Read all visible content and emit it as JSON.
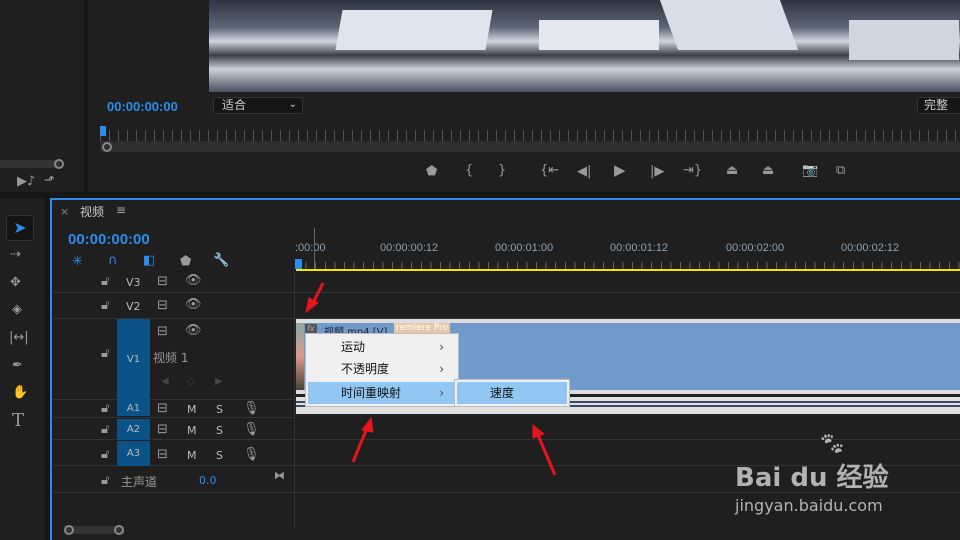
{
  "monitor": {
    "timecode": "00:00:00:00",
    "zoom_select": "适合",
    "quality_select": "完整"
  },
  "timeline": {
    "tab_title": "视频",
    "timecode": "00:00:00:00",
    "ruler_labels": [
      ":00:00",
      "00:00:00:12",
      "00:00:01:00",
      "00:00:01:12",
      "00:00:02:00",
      "00:00:02:12"
    ],
    "tracks": {
      "v3": "V3",
      "v2": "V2",
      "v1": "V1",
      "v1_name": "视频 1",
      "a1": "A1",
      "a2": "A2",
      "a3": "A3",
      "mute": "M",
      "solo": "S",
      "master": "主声道",
      "master_value": "0.0"
    },
    "clip": {
      "label": "视频.mp4 [V]",
      "overlay": "remiere Pro",
      "fx": "fx"
    }
  },
  "context_menu": {
    "items": [
      {
        "label": "运动"
      },
      {
        "label": "不透明度"
      },
      {
        "label": "时间重映射",
        "highlighted": true
      }
    ],
    "submenu": [
      {
        "label": "速度",
        "highlighted": true
      }
    ]
  },
  "watermark": {
    "brand": "Bai du 经验",
    "url": "jingyan.baidu.com"
  },
  "colors": {
    "accent": "#2d8ceb",
    "clip": "#7099cc",
    "menu_highlight": "#92c7f4",
    "playhead_bar": "#f5e600",
    "annotation": "#e8141c"
  }
}
